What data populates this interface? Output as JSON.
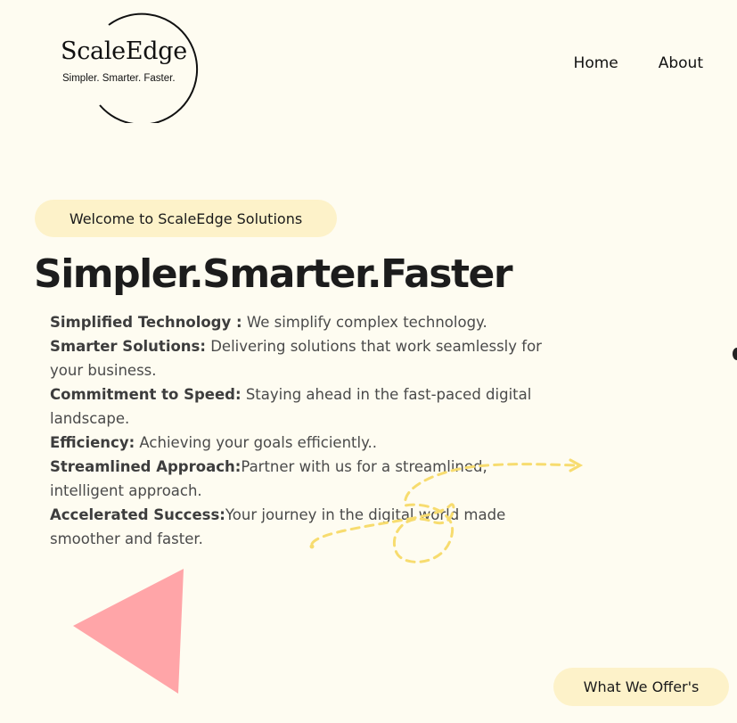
{
  "brand": {
    "name": "ScaleEdge",
    "tagline": "Simpler. Smarter. Faster."
  },
  "nav": {
    "home": "Home",
    "about": "About"
  },
  "hero": {
    "welcome": "Welcome to ScaleEdge Solutions",
    "headline": "Simpler.Smarter.Faster",
    "features": [
      {
        "title": "Simplified Technology :",
        "text": " We simplify complex technology."
      },
      {
        "title": "Smarter Solutions:",
        "text": " Delivering solutions that work seamlessly for your business."
      },
      {
        "title": "Commitment to Speed:",
        "text": " Staying ahead in the fast-paced digital landscape."
      },
      {
        "title": "Efficiency:",
        "text": " Achieving your goals efficiently.."
      },
      {
        "title": "Streamlined Approach:",
        "text": "Partner with us for a streamlined, intelligent approach."
      },
      {
        "title": "Accelerated Success:",
        "text": "Your journey in the digital world made smoother and faster."
      }
    ]
  },
  "cta": {
    "offer": "What We Offer's"
  },
  "decor": {
    "triangle_icon": "triangle-shape",
    "squiggle_icon": "dashed-arrow-icon",
    "colors": {
      "background": "#fefcf1",
      "pill": "#fdf2c9",
      "triangle": "#ffa5a8",
      "squiggle": "#f7dc6f"
    }
  }
}
